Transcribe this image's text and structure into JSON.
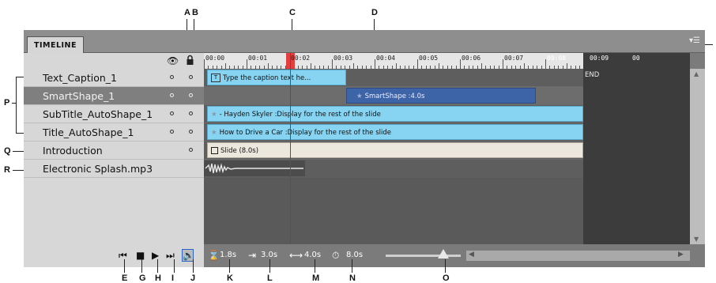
{
  "panel": {
    "title": "TIMELINE",
    "menu_icon": "▾☰"
  },
  "ruler": {
    "labels": [
      "00:00",
      "00:01",
      "00:02",
      "00:03",
      "00:04",
      "00:05",
      "00:06",
      "00:07",
      "00:08",
      "00:09",
      "00"
    ]
  },
  "end_label": "END",
  "layers": [
    {
      "name": "Text_Caption_1",
      "visible": true,
      "locked_dot": true,
      "selected": false
    },
    {
      "name": "SmartShape_1",
      "visible": true,
      "locked_dot": true,
      "selected": true
    },
    {
      "name": "SubTitle_AutoShape_1",
      "visible": true,
      "locked_dot": true,
      "selected": false
    },
    {
      "name": "Title_AutoShape_1",
      "visible": true,
      "locked_dot": true,
      "selected": false
    },
    {
      "name": "Introduction",
      "visible": false,
      "locked_dot": true,
      "selected": false
    },
    {
      "name": "Electronic Splash.mp3",
      "visible": false,
      "locked_dot": false,
      "selected": false
    }
  ],
  "tracks": {
    "caption": "Type the caption text he...",
    "smartshape": "SmartShape :4.0s",
    "subtitle": "- Hayden Skyler :Display for the rest of the slide",
    "title": "How to Drive a Car :Display for the rest of the slide",
    "slide": "Slide (8.0s)"
  },
  "controls": {
    "duration": "1.8s",
    "start": "3.0s",
    "length": "4.0s",
    "slide_duration": "8.0s"
  },
  "callouts": {
    "top": [
      "A",
      "B",
      "C",
      "D"
    ],
    "left": [
      "P",
      "Q",
      "R"
    ],
    "bottom": [
      "E",
      "F",
      "G",
      "H",
      "I",
      "J",
      "K",
      "L",
      "M",
      "N",
      "O"
    ]
  }
}
